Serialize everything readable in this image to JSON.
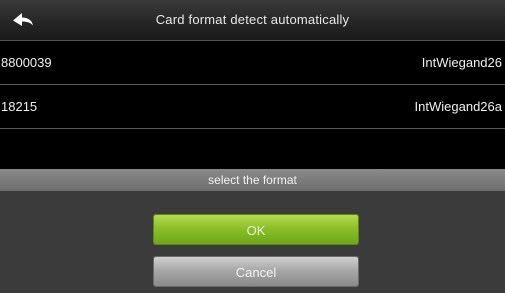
{
  "header": {
    "title": "Card format detect automatically",
    "back_icon": "back-arrow-icon"
  },
  "rows": [
    {
      "value": "8800039",
      "format": "IntWiegand26"
    },
    {
      "value": "18215",
      "format": "IntWiegand26a"
    }
  ],
  "dialog": {
    "title": "select the format",
    "ok_label": "OK",
    "cancel_label": "Cancel"
  },
  "colors": {
    "background": "#000000",
    "ok_button": "#8cc02a",
    "cancel_button": "#a8a8a8",
    "dialog_background": "#3b3b3b"
  }
}
